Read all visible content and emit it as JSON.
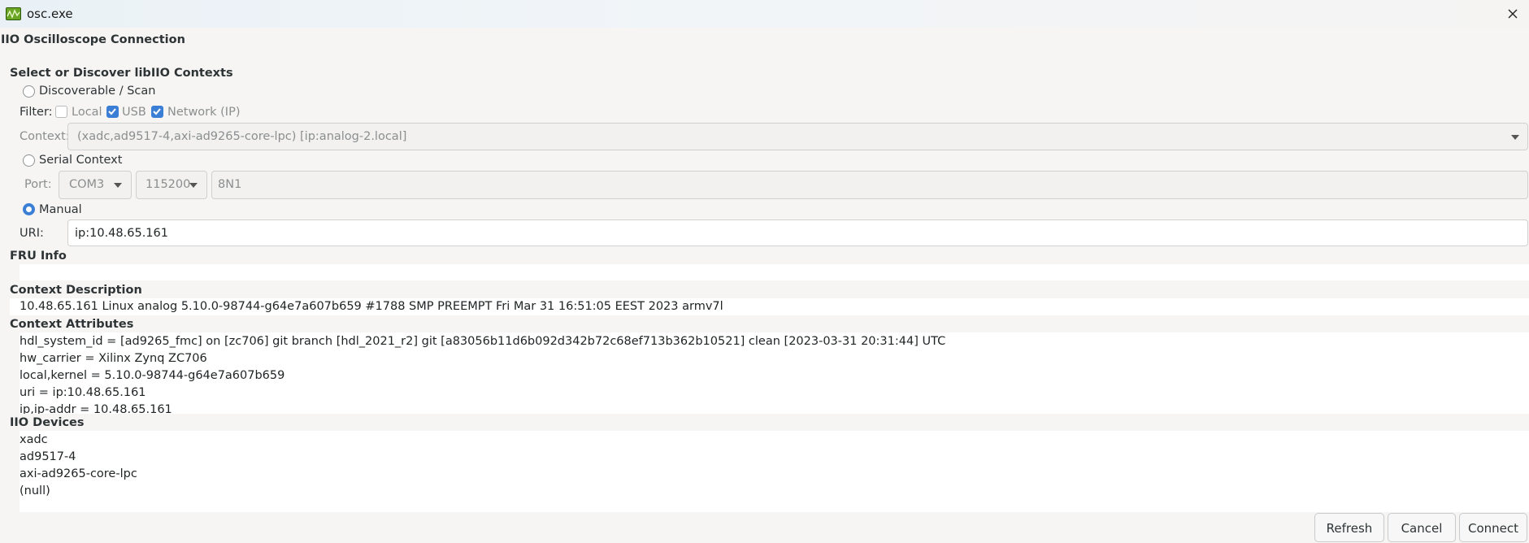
{
  "window": {
    "title": "osc.exe"
  },
  "dialog": {
    "heading": "IIO Oscilloscope Connection"
  },
  "discover": {
    "section_title": "Select or Discover libIIO Contexts",
    "radio_label": "Discoverable / Scan",
    "filter_label": "Filter:",
    "filters": [
      {
        "label": "Local",
        "checked": false
      },
      {
        "label": "USB",
        "checked": true
      },
      {
        "label": "Network (IP)",
        "checked": true
      }
    ],
    "context_label": "Context:",
    "context_value": "(xadc,ad9517-4,axi-ad9265-core-lpc) [ip:analog-2.local]"
  },
  "serial": {
    "radio_label": "Serial Context",
    "port_label": "Port:",
    "port_value": "COM3",
    "baud_value": "115200",
    "format_value": "8N1"
  },
  "manual": {
    "radio_label": "Manual",
    "selected": true,
    "uri_label": "URI:",
    "uri_value": "ip:10.48.65.161"
  },
  "fru": {
    "title": "FRU Info"
  },
  "description": {
    "title": "Context Description",
    "text": "10.48.65.161 Linux analog 5.10.0-98744-g64e7a607b659 #1788 SMP PREEMPT Fri Mar 31 16:51:05 EEST 2023 armv7l"
  },
  "attributes": {
    "title": "Context Attributes",
    "lines": [
      "hdl_system_id = [ad9265_fmc] on [zc706] git branch [hdl_2021_r2] git [a83056b11d6b092d342b72c68ef713b362b10521] clean [2023-03-31 20:31:44] UTC",
      "hw_carrier = Xilinx Zynq ZC706",
      "local,kernel = 5.10.0-98744-g64e7a607b659",
      "uri = ip:10.48.65.161",
      "ip,ip-addr = 10.48.65.161"
    ]
  },
  "devices": {
    "title": "IIO Devices",
    "items": [
      "xadc",
      "ad9517-4",
      "axi-ad9265-core-lpc",
      "(null)"
    ]
  },
  "buttons": {
    "refresh": "Refresh",
    "cancel": "Cancel",
    "connect": "Connect"
  }
}
